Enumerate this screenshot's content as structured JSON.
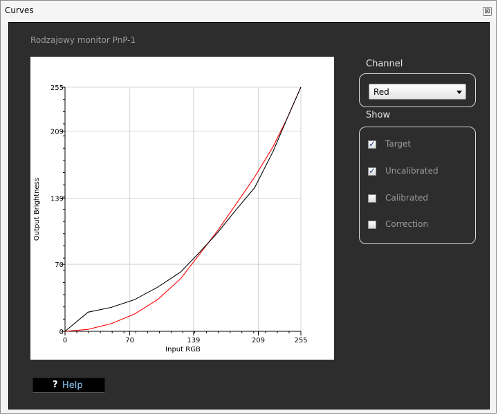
{
  "window": {
    "title": "Curves",
    "close_glyph": "⊠"
  },
  "monitor_name": "Rodzajowy monitor PnP-1",
  "channel": {
    "label": "Channel",
    "selected": "Red"
  },
  "show": {
    "label": "Show",
    "options": [
      {
        "label": "Target",
        "checked": true
      },
      {
        "label": "Uncalibrated",
        "checked": true
      },
      {
        "label": "Calibrated",
        "checked": false
      },
      {
        "label": "Correction",
        "checked": false
      }
    ]
  },
  "help": {
    "icon": "question-icon",
    "glyph": "?",
    "label": "Help"
  },
  "chart_data": {
    "type": "line",
    "xlabel": "Input RGB",
    "ylabel": "Output Brightness",
    "xlim": [
      0,
      255
    ],
    "ylim": [
      0,
      255
    ],
    "xticks": [
      0,
      70,
      139,
      209,
      255
    ],
    "yticks": [
      0,
      70,
      139,
      209,
      255
    ],
    "grid": true,
    "series": [
      {
        "color": "#ff0000",
        "x": [
          0,
          25,
          50,
          75,
          100,
          125,
          145,
          165,
          185,
          205,
          225,
          240,
          255
        ],
        "y": [
          0,
          2,
          8,
          18,
          33,
          55,
          80,
          105,
          133,
          161,
          193,
          222,
          255
        ]
      },
      {
        "color": "#000000",
        "x": [
          0,
          25,
          50,
          75,
          100,
          125,
          145,
          165,
          185,
          205,
          225,
          240,
          255
        ],
        "y": [
          0,
          20,
          25,
          33,
          46,
          62,
          82,
          103,
          127,
          150,
          188,
          222,
          255
        ]
      }
    ]
  }
}
